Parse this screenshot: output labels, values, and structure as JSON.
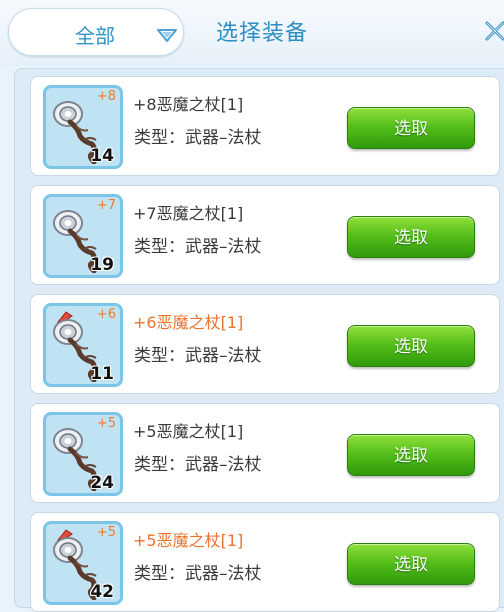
{
  "header": {
    "filter_label": "全部",
    "title": "选择装备"
  },
  "items": [
    {
      "refine": "+8",
      "count": "14",
      "name": "+8恶魔之杖[1]",
      "type": "类型：武器–法杖",
      "button": "选取",
      "highlight": false
    },
    {
      "refine": "+7",
      "count": "19",
      "name": "+7恶魔之杖[1]",
      "type": "类型：武器–法杖",
      "button": "选取",
      "highlight": false
    },
    {
      "refine": "+6",
      "count": "11",
      "name": "+6恶魔之杖[1]",
      "type": "类型：武器–法杖",
      "button": "选取",
      "highlight": true
    },
    {
      "refine": "+5",
      "count": "24",
      "name": "+5恶魔之杖[1]",
      "type": "类型：武器–法杖",
      "button": "选取",
      "highlight": false
    },
    {
      "refine": "+5",
      "count": "42",
      "name": "+5恶魔之杖[1]",
      "type": "类型：武器–法杖",
      "button": "选取",
      "highlight": true
    }
  ],
  "colors": {
    "accent": "#2d8fc4",
    "highlight_name": "#e9742f",
    "button_green": "#57bf1b"
  },
  "icons": {
    "filter_arrow": "chevron-down-icon",
    "close": "close-icon",
    "item": "staff-icon",
    "badge": "red-flag-icon"
  }
}
